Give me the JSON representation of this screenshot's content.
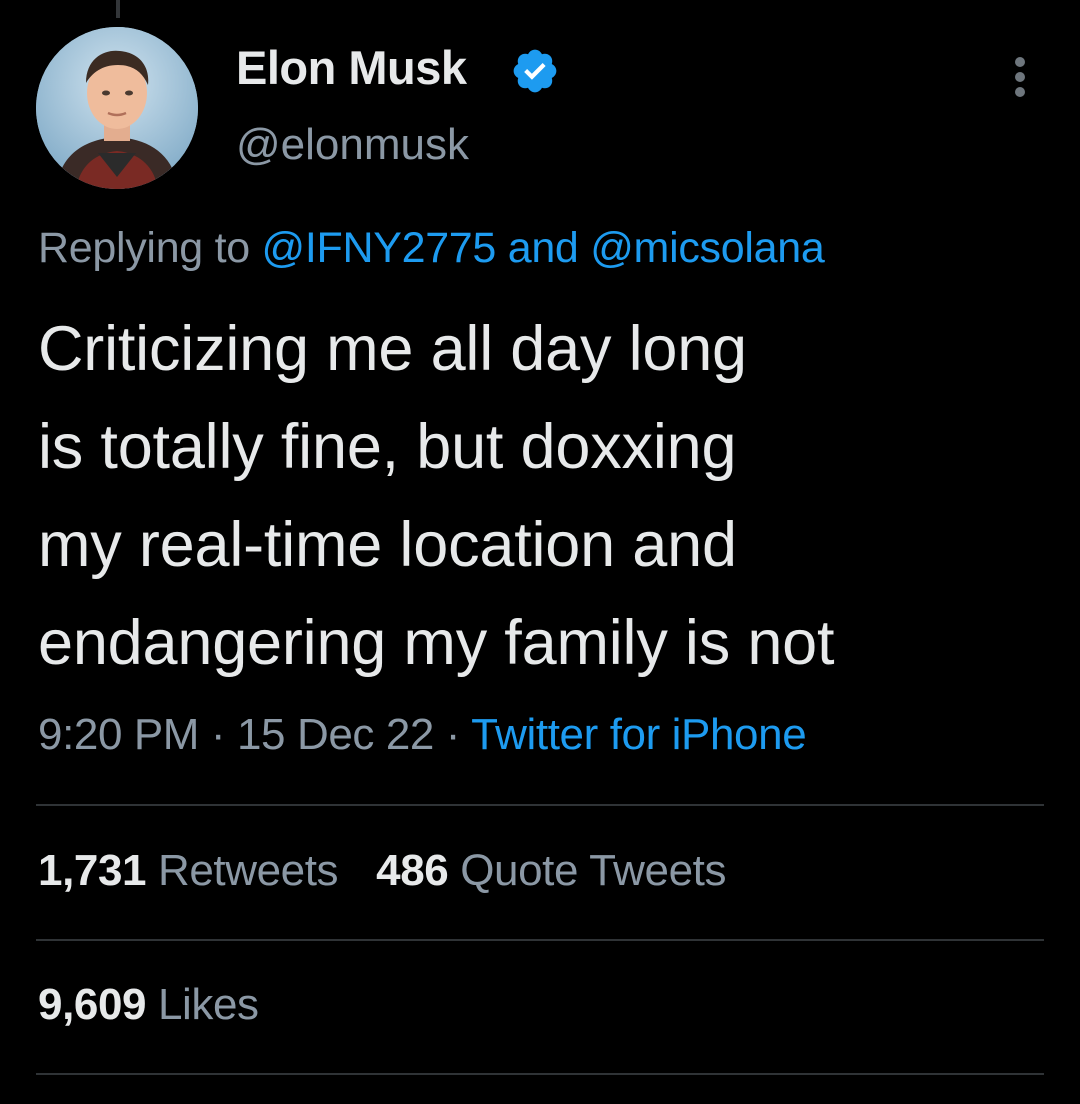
{
  "author": {
    "display_name": "Elon Musk",
    "handle": "@elonmusk",
    "verified_icon": "verified-badge-icon"
  },
  "reply": {
    "prefix": "Replying to",
    "mention_1": "@IFNY2775",
    "conjunction": "and",
    "mention_2": "@micsolana"
  },
  "body": {
    "lines": [
      "Criticizing me all day long",
      "is totally fine, but doxxing",
      "my real-time location and",
      "endangering my family is not"
    ]
  },
  "meta": {
    "time": "9:20 PM",
    "separator": "·",
    "date": "15 Dec 22",
    "source": "Twitter for iPhone"
  },
  "stats": {
    "retweets_count": "1,731",
    "retweets_label": "Retweets",
    "quotes_count": "486",
    "quotes_label": "Quote Tweets",
    "likes_count": "9,609",
    "likes_label": "Likes"
  },
  "colors": {
    "background": "#000000",
    "text_primary": "#e7e9ea",
    "text_secondary": "#8b98a5",
    "link": "#1d9bf0",
    "divider": "#2f3336"
  }
}
